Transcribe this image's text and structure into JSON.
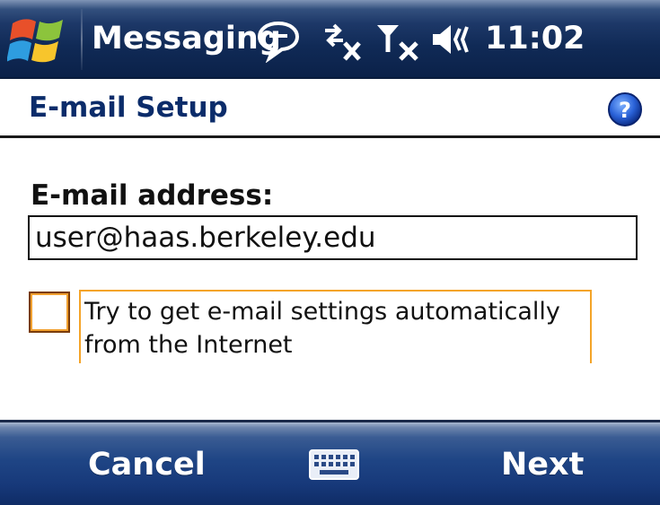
{
  "titlebar": {
    "app_title": "Messaging",
    "clock": "11:02",
    "icons": {
      "start": "windows-flag-icon",
      "notification": "speech-bubble-icon",
      "connectivity": "data-disconnected-icon",
      "signal": "no-signal-icon",
      "volume": "speaker-icon"
    }
  },
  "header": {
    "title": "E-mail Setup",
    "help_icon": "help-icon"
  },
  "form": {
    "email_label": "E-mail address:",
    "email_value": "user@haas.berkeley.edu",
    "auto_settings_label": "Try to get e-mail settings automatically from the Internet",
    "auto_settings_checked": false
  },
  "softkeys": {
    "left": "Cancel",
    "right": "Next",
    "center_icon": "keyboard-icon"
  },
  "colors": {
    "titlebar": "#102a56",
    "header_title": "#0b2c6a",
    "focus_border": "#f4a428",
    "softkey_bar": "#1f4585"
  }
}
